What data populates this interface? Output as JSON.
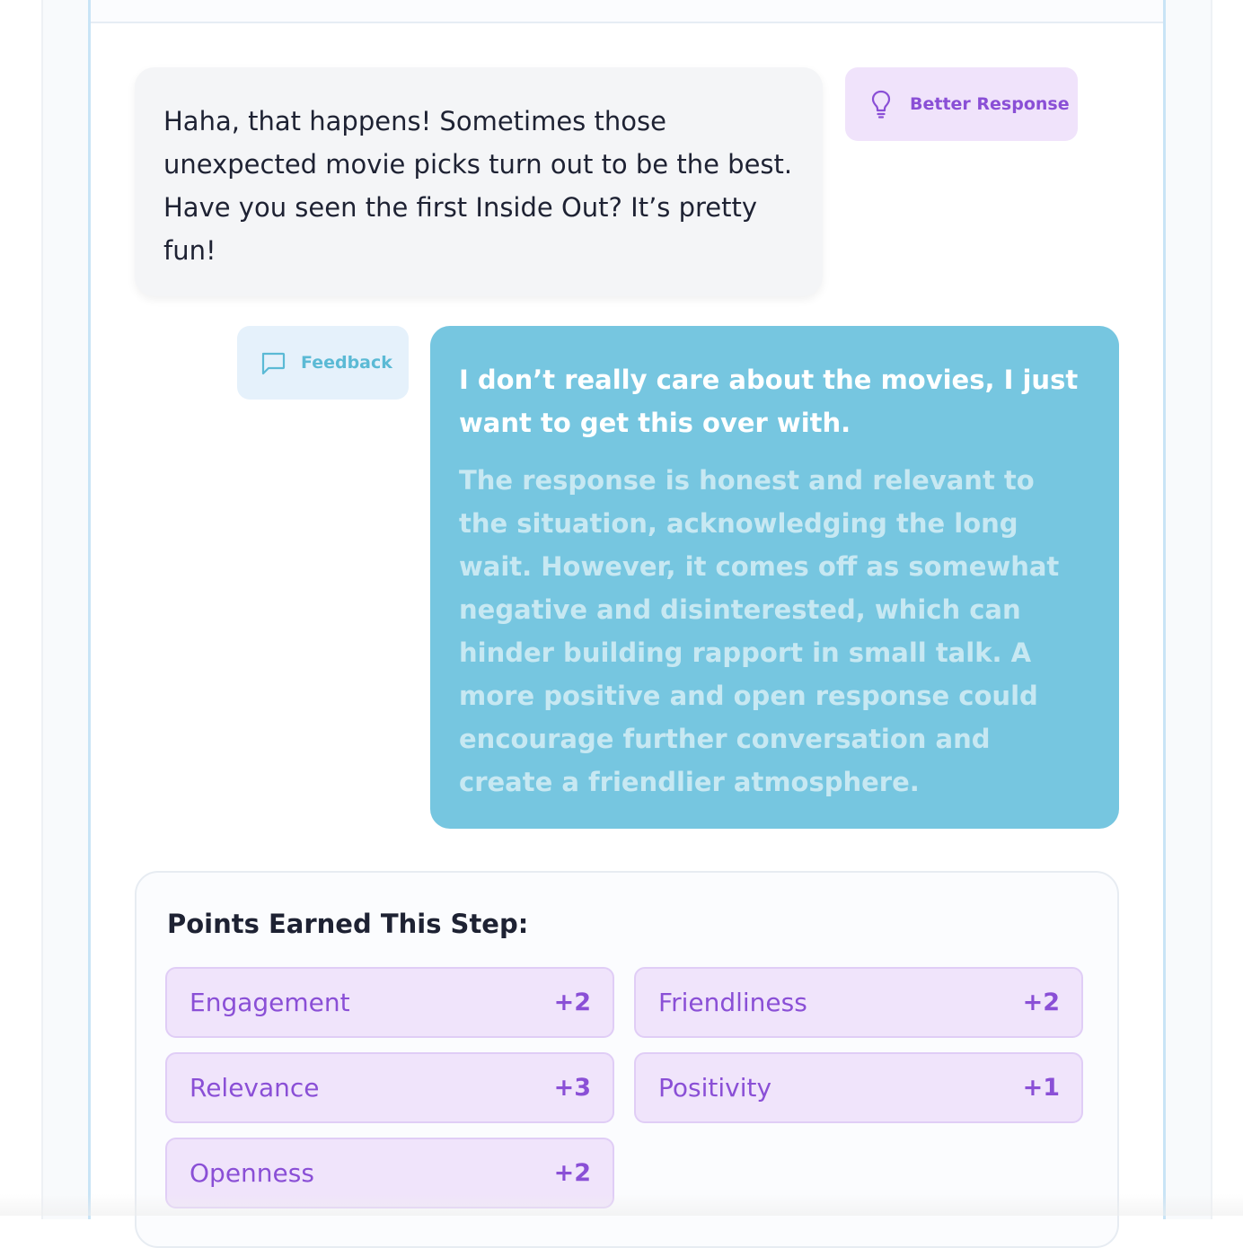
{
  "conversation": {
    "bot_message": "Haha, that happens! Sometimes those unexpected movie picks turn out to be the best. Have you seen the first Inside Out? It’s pretty fun!",
    "better_response_label": "Better Response",
    "feedback_label": "Feedback",
    "user_message": "I don’t really care about the movies, I just want to get this over with.",
    "user_feedback": "The response is honest and relevant to the situation, acknowledging the long wait. However, it comes off as somewhat negative and disinterested, which can hinder building rapport in small talk. A more positive and open response could encourage further conversation and create a friendlier atmosphere."
  },
  "points": {
    "title": "Points Earned This Step:",
    "items": [
      {
        "label": "Engagement",
        "value": "+2"
      },
      {
        "label": "Friendliness",
        "value": "+2"
      },
      {
        "label": "Relevance",
        "value": "+3"
      },
      {
        "label": "Positivity",
        "value": "+1"
      },
      {
        "label": "Openness",
        "value": "+2"
      }
    ]
  },
  "colors": {
    "accent_purple": "#8a4fd6",
    "user_bubble": "#76c6e0",
    "bot_bubble": "#f4f5f7",
    "feedback_accent": "#5bbad5"
  },
  "icons": {
    "better_response": "lightbulb-icon",
    "feedback": "message-square-icon"
  }
}
